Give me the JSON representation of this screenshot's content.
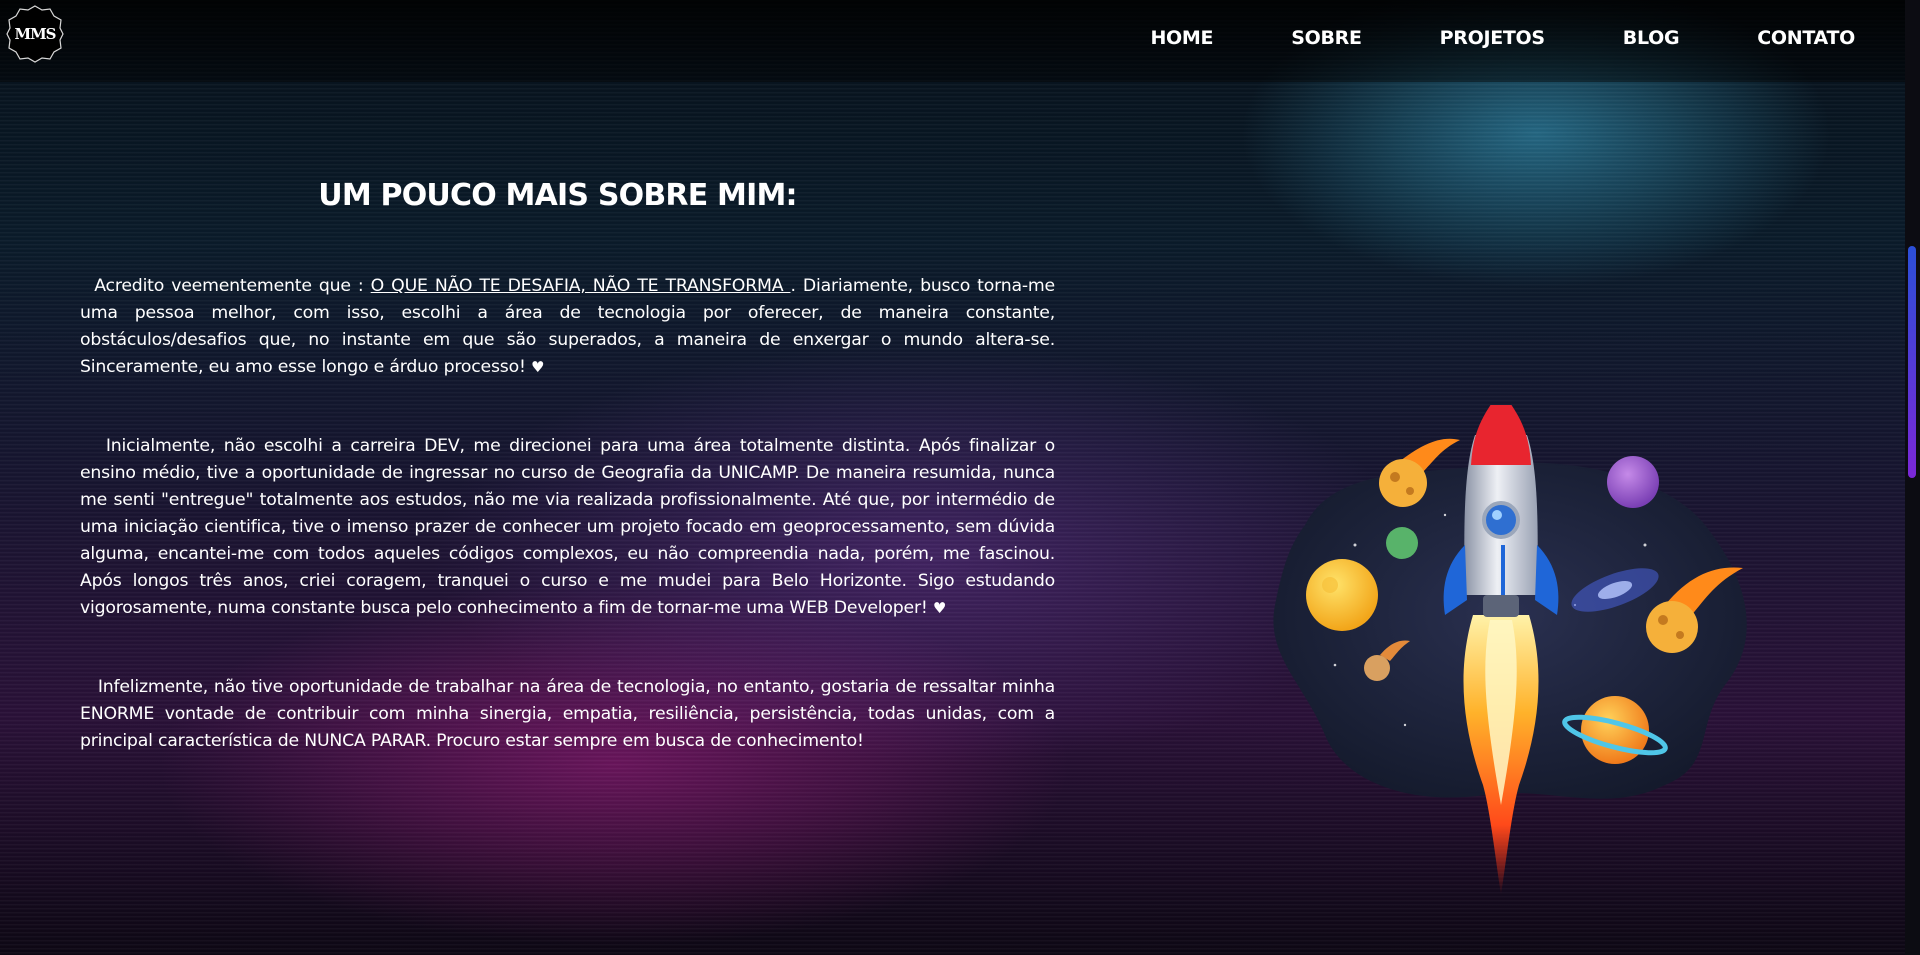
{
  "logo": {
    "text": "MMS"
  },
  "nav": {
    "items": [
      "HOME",
      "SOBRE",
      "PROJETOS",
      "BLOG",
      "CONTATO"
    ]
  },
  "about": {
    "title": "UM POUCO MAIS SOBRE MIM:",
    "p1_prefix": "Acredito veementemente que : ",
    "p1_highlight": "O QUE NÃO TE DESAFIA, NÃO TE TRANSFORMA ",
    "p1_rest": ". Diariamente, busco torna-me uma pessoa melhor, com isso, escolhi a área de tecnologia por oferecer, de maneira constante, obstáculos/desafios que, no instante em que são superados, a maneira de enxergar o mundo altera-se. Sinceramente, eu amo esse longo e árduo processo!",
    "p2": "Inicialmente, não escolhi a carreira DEV, me direcionei para uma área totalmente distinta. Após finalizar o ensino médio, tive a oportunidade de ingressar no curso de Geografia da UNICAMP. De maneira resumida, nunca me senti \"entregue\" totalmente aos estudos, não me via realizada profissionalmente. Até que, por intermédio de uma iniciação cientifica, tive o imenso prazer de conhecer um projeto focado em geoprocessamento, sem dúvida alguma, encantei-me com todos aqueles códigos complexos, eu não compreendia nada, porém, me fascinou. Após longos três anos, criei coragem, tranquei o curso e me mudei para Belo Horizonte.     Sigo estudando vigorosamente, numa constante busca pelo conhecimento a fim de tornar-me uma WEB Developer!",
    "p3": "Infelizmente, não tive oportunidade de trabalhar na área de tecnologia, no entanto, gostaria de ressaltar minha ENORME vontade de contribuir com minha sinergia, empatia, resiliência, persistência, todas unidas, com a principal característica de NUNCA PARAR. Procuro estar sempre em busca de conhecimento!",
    "heart": "♥"
  },
  "colors": {
    "accent_scroll_top": "#2b4fd8",
    "accent_scroll_bottom": "#7b27d8",
    "text": "#ffffff"
  },
  "icons": {
    "logo": "mms-badge-icon",
    "illustration": "rocket-planets-illustration"
  }
}
